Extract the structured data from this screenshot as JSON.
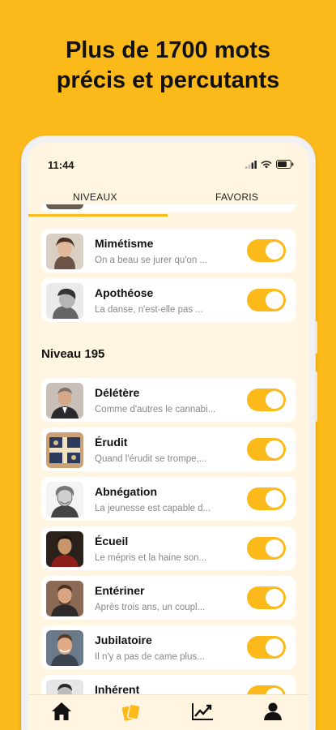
{
  "headline": {
    "line1": "Plus de 1700 mots",
    "line2": "précis et percutants"
  },
  "status": {
    "time": "11:44"
  },
  "tabs": [
    {
      "label": "NIVEAUX"
    },
    {
      "label": "FAVORIS"
    }
  ],
  "section": {
    "title": "Niveau 195"
  },
  "items": [
    {
      "word": "Mimétisme",
      "quote": "On a beau se jurer qu'on ...",
      "enabled": true
    },
    {
      "word": "Apothéose",
      "quote": "La danse, n'est-elle pas ...",
      "enabled": true
    },
    {
      "word": "Délétère",
      "quote": "Comme d'autres le cannabi...",
      "enabled": true
    },
    {
      "word": "Érudit",
      "quote": "Quand l'érudit se trompe,...",
      "enabled": true
    },
    {
      "word": "Abnégation",
      "quote": "La jeunesse est capable d...",
      "enabled": true
    },
    {
      "word": "Écueil",
      "quote": "Le mépris et la haine son...",
      "enabled": true
    },
    {
      "word": "Entériner",
      "quote": "Après trois ans, un coupl...",
      "enabled": true
    },
    {
      "word": "Jubilatoire",
      "quote": "Il n'y a pas de came plus...",
      "enabled": true
    },
    {
      "word": "Inhérent",
      "quote": "",
      "enabled": true
    }
  ],
  "nav": [
    "home-icon",
    "cards-icon",
    "stats-icon",
    "profile-icon"
  ],
  "colors": {
    "accent": "#FBBA1A",
    "screen_bg": "#FFF5E0",
    "card_bg": "#FFFFFF"
  }
}
